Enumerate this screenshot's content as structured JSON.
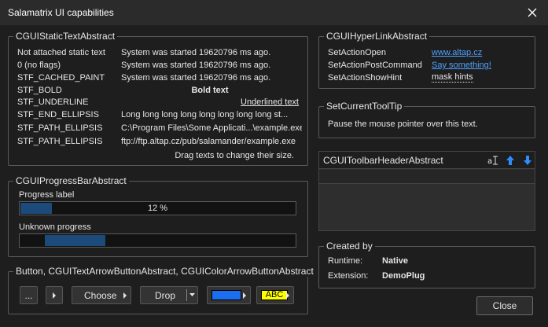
{
  "window": {
    "title": "Salamatrix UI capabilities"
  },
  "static_text": {
    "title": "CGUIStaticTextAbstract",
    "rows": [
      {
        "label": "Not attached static text",
        "value": "System was started 19620796 ms ago."
      },
      {
        "label": "0 (no flags)",
        "value": "System was started 19620796 ms ago."
      },
      {
        "label": "STF_CACHED_PAINT",
        "value": "System was started 19620796 ms ago."
      },
      {
        "label": "STF_BOLD",
        "value": "Bold text"
      },
      {
        "label": "STF_UNDERLINE",
        "value": "Underlined text"
      },
      {
        "label": "STF_END_ELLIPSIS",
        "value": "Long long long long long long long long st..."
      },
      {
        "label": "STF_PATH_ELLIPSIS",
        "value": "C:\\Program Files\\Some Applicati...\\example.exe"
      },
      {
        "label": "STF_PATH_ELLIPSIS",
        "value": "ftp://ftp.altap.cz/pub/salamander/example.exe"
      }
    ],
    "hint": "Drag texts to change their size."
  },
  "hyperlink": {
    "title": "CGUIHyperLinkAbstract",
    "rows": [
      {
        "label": "SetActionOpen",
        "value": "www.altap.cz"
      },
      {
        "label": "SetActionPostCommand",
        "value": "Say something!"
      },
      {
        "label": "SetActionShowHint",
        "value": "mask hints"
      }
    ]
  },
  "tooltip": {
    "title": "SetCurrentToolTip",
    "text": "Pause the mouse pointer over this text."
  },
  "progress": {
    "title": "CGUIProgressBarAbstract",
    "label1": "Progress label",
    "value1": 0.12,
    "text1": "12 %",
    "label2": "Unknown progress",
    "marquee_start": 0.09,
    "marquee_end": 0.31
  },
  "toolbar_header": {
    "title": "CGUIToolbarHeaderAbstract",
    "icon1": "text-cursor-icon",
    "icon2": "arrow-up-icon",
    "icon3": "arrow-down-icon"
  },
  "buttons": {
    "title": "Button, CGUITextArrowButtonAbstract, CGUIColorArrowButtonAbstract",
    "ellipsis_label": "...",
    "choose_label": "Choose",
    "drop_label": "Drop",
    "color_fg_text": "ABC",
    "color1": "#1c6ef0",
    "color2_bg": "#ffff00",
    "color2_fg": "#000000"
  },
  "created_by": {
    "title": "Created by",
    "runtime_label": "Runtime:",
    "runtime_value": "Native",
    "extension_label": "Extension:",
    "extension_value": "DemoPlug"
  },
  "close_button": {
    "label": "Close"
  },
  "colors": {
    "accent": "#4ea1ff",
    "progress_fill": "#1c4a7a"
  }
}
